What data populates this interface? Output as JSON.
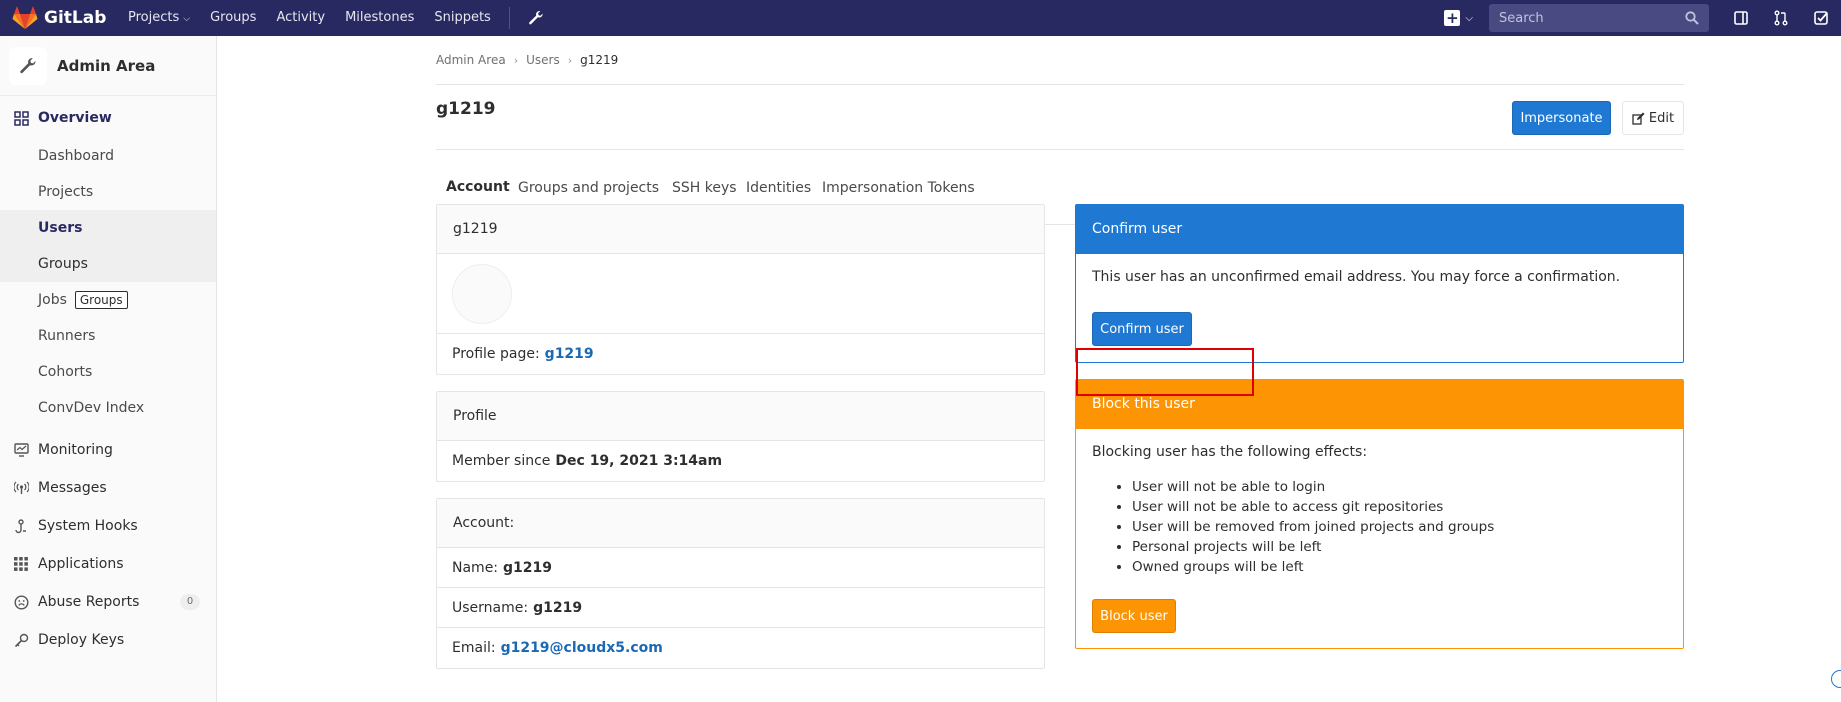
{
  "navbar": {
    "logo_text": "GitLab",
    "links": [
      "Projects",
      "Groups",
      "Activity",
      "Milestones",
      "Snippets"
    ],
    "search_placeholder": "Search",
    "bg_color": "#292961"
  },
  "sidebar": {
    "title": "Admin Area",
    "overview": "Overview",
    "overview_items": [
      "Dashboard",
      "Projects",
      "Users",
      "Groups",
      "Jobs",
      "Runners",
      "Cohorts",
      "ConvDev Index"
    ],
    "jobs_tooltip": "Groups",
    "items": [
      "Monitoring",
      "Messages",
      "System Hooks",
      "Applications",
      "Abuse Reports",
      "Deploy Keys"
    ],
    "abuse_count": "0"
  },
  "breadcrumb": [
    "Admin Area",
    "Users",
    "g1219"
  ],
  "page": {
    "title": "g1219",
    "impersonate_label": "Impersonate",
    "edit_label": "Edit"
  },
  "tabs": [
    "Account",
    "Groups and projects",
    "SSH keys",
    "Identities",
    "Impersonation Tokens"
  ],
  "user_card": {
    "header": "g1219",
    "profile_label": "Profile page:",
    "profile_link": "g1219"
  },
  "profile_card": {
    "header": "Profile",
    "member_label": "Member since",
    "member_since": "Dec 19, 2021 3:14am"
  },
  "account_card": {
    "header": "Account:",
    "name_label": "Name:",
    "name": "g1219",
    "username_label": "Username:",
    "username": "g1219",
    "email_label": "Email:",
    "email": "g1219@cloudx5.com"
  },
  "confirm_card": {
    "header": "Confirm user",
    "text": "This user has an unconfirmed email address. You may force a confirmation.",
    "button": "Confirm user",
    "color": "#1f78d1"
  },
  "block_card": {
    "header": "Block this user",
    "intro": "Blocking user has the following effects:",
    "effects": [
      "User will not be able to login",
      "User will not be able to access git repositories",
      "User will be removed from joined projects and groups",
      "Personal projects will be left",
      "Owned groups will be left"
    ],
    "button": "Block user",
    "color": "#fc9403"
  }
}
